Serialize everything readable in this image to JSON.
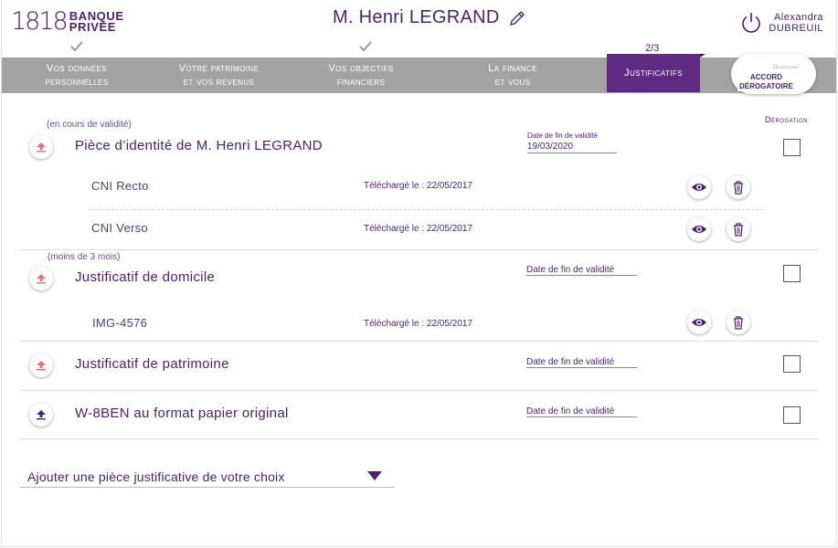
{
  "header": {
    "logo_number": "1818",
    "logo_line1": "BANQUE",
    "logo_line2": "PRIVÉE",
    "client_name": "M. Henri LEGRAND",
    "user_first": "Alexandra",
    "user_last": "DUBREUIL"
  },
  "steps": {
    "progress": "2/3",
    "items": [
      {
        "l1": "Vos données",
        "l2": "personnelles",
        "done": true
      },
      {
        "l1": "Votre patrimoine",
        "l2": "et vos revenus",
        "done": false
      },
      {
        "l1": "Vos objectifs",
        "l2": "financiers",
        "done": true
      },
      {
        "l1": "La finance",
        "l2": "et vous",
        "done": false
      },
      {
        "l1": "Justificatifs",
        "l2": "",
        "active": true
      }
    ],
    "accord_bg_l1": "Ouverture/",
    "accord_bg_l2": "ation",
    "accord_l1": "ACCORD",
    "accord_l2": "DÉROGATOIRE"
  },
  "derogation_header": "Dérogation",
  "documents": {
    "identity": {
      "note": "(en cours de validité)",
      "title": "Pièce d’identité de M. Henri LEGRAND",
      "date_label": "Date de fin de validité",
      "date_value": "19/03/2020",
      "files": [
        {
          "name": "CNI Recto",
          "uploaded": "Téléchargé le : 22/05/2017"
        },
        {
          "name": "CNI Verso",
          "uploaded": "Téléchargé le : 22/05/2017"
        }
      ]
    },
    "domicile": {
      "note": "(moins de 3 mois)",
      "title": "Justificatif de domicile",
      "date_label": "Date de fin de validité",
      "files": [
        {
          "name": "IMG-4576",
          "uploaded": "Téléchargé le : 22/05/2017"
        }
      ]
    },
    "patrimoine": {
      "title": "Justificatif de patrimoine",
      "date_label": "Date de fin de validité"
    },
    "w8ben": {
      "title": "W-8BEN au format papier original",
      "date_label": "Date de fin de validité"
    }
  },
  "add_select": {
    "label": "Ajouter une pièce justificative de votre choix"
  },
  "colors": {
    "brand": "#4b1f6e",
    "active_step": "#5e2a82",
    "step_bar": "#a3a3a3",
    "upload_missing": "#f26b6b"
  }
}
